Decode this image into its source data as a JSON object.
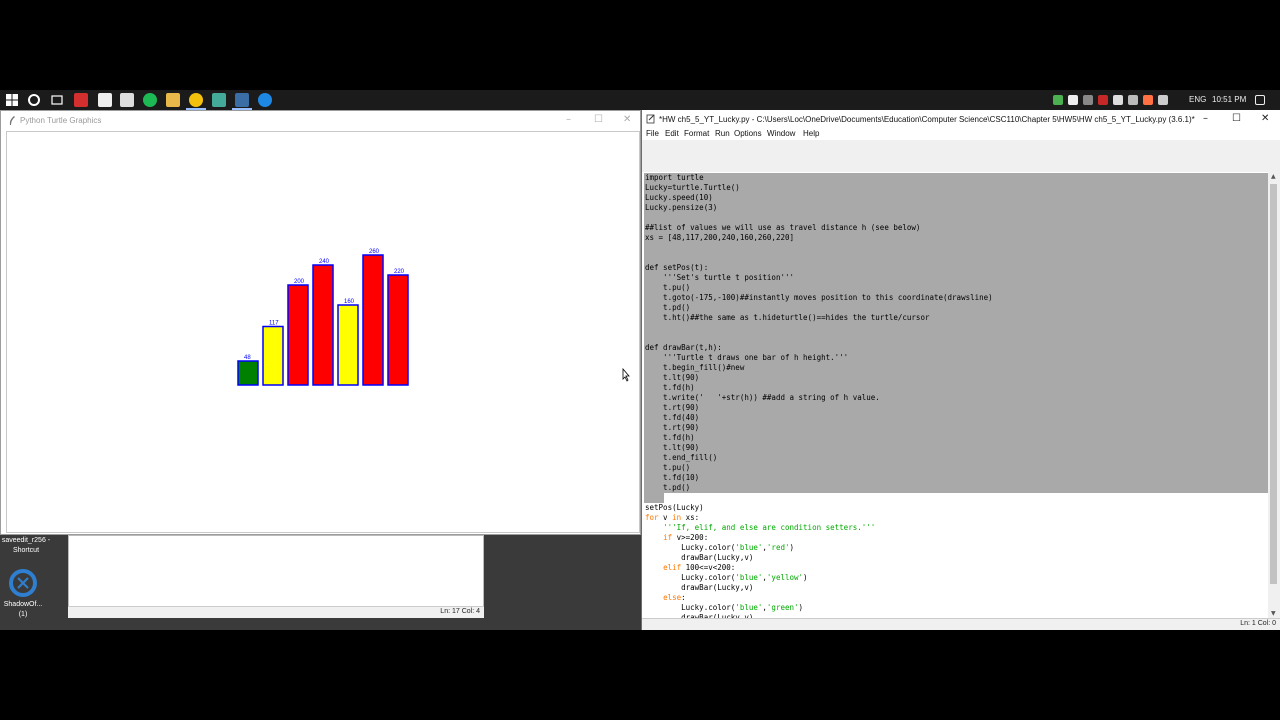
{
  "taskbar": {
    "tray_lang": "ENG",
    "tray_time": "10:51 PM"
  },
  "desktop": {
    "shortcut_top_label": "saveedit_r256 - Shortcut",
    "shortcut_app_label": "ShadowOf... (1)"
  },
  "bg_editor": {
    "status": "Ln: 17   Col: 4"
  },
  "turtle_window": {
    "title": "Python Turtle Graphics",
    "controls": {
      "minimize": "–",
      "maximize": "☐",
      "close": "✕"
    }
  },
  "chart_data": {
    "type": "bar",
    "values": [
      48,
      117,
      200,
      240,
      160,
      260,
      220
    ],
    "categories": [
      "48",
      "117",
      "200",
      "240",
      "160",
      "260",
      "220"
    ],
    "colors": [
      "#008000",
      "#ffff00",
      "#ff0000",
      "#ff0000",
      "#ffff00",
      "#ff0000",
      "#ff0000"
    ],
    "outline_color": "#0000ff",
    "label_color": "#0000ff"
  },
  "idle_window": {
    "title": "*HW ch5_5_YT_Lucky.py - C:\\Users\\Loc\\OneDrive\\Documents\\Education\\Computer Science\\CSC110\\Chapter 5\\HW5\\HW ch5_5_YT_Lucky.py (3.6.1)*",
    "controls": {
      "minimize": "–",
      "maximize": "☐",
      "close": "✕"
    },
    "menu": [
      "File",
      "Edit",
      "Format",
      "Run",
      "Options",
      "Window",
      "Help"
    ],
    "code": [
      "import turtle",
      "Lucky=turtle.Turtle()",
      "Lucky.speed(10)",
      "Lucky.pensize(3)",
      "",
      "##list of values we will use as travel distance h (see below)",
      "xs = [48,117,200,240,160,260,220]",
      "",
      "",
      "def setPos(t):",
      "    '''Set's turtle t position'''",
      "    t.pu()",
      "    t.goto(-175,-100)##instantly moves position to this coordinate(drawsline)",
      "    t.pd()",
      "    t.ht()##the same as t.hideturtle()==hides the turtle/cursor",
      "",
      "",
      "def drawBar(t,h):",
      "    '''Turtle t draws one bar of h height.'''",
      "    t.begin_fill()#new",
      "    t.lt(90)",
      "    t.fd(h)",
      "    t.write('   '+str(h)) ##add a string of h value.",
      "    t.rt(90)",
      "    t.fd(40)",
      "    t.rt(90)",
      "    t.fd(h)",
      "    t.lt(90)",
      "    t.end_fill()",
      "    t.pu()",
      "    t.fd(10)",
      "    t.pd()",
      "",
      "setPos(Lucky)",
      "for v in xs:",
      "    '''If, elif, and else are condition setters.'''",
      "    if v>=200:",
      "        Lucky.color('blue','red')",
      "        drawBar(Lucky,v)",
      "    elif 100<=v<200:",
      "        Lucky.color('blue','yellow')",
      "        drawBar(Lucky,v)",
      "    else:",
      "        Lucky.color('blue','green')",
      "        drawBar(Lucky,v)"
    ],
    "status": "Ln: 1   Col: 0"
  }
}
